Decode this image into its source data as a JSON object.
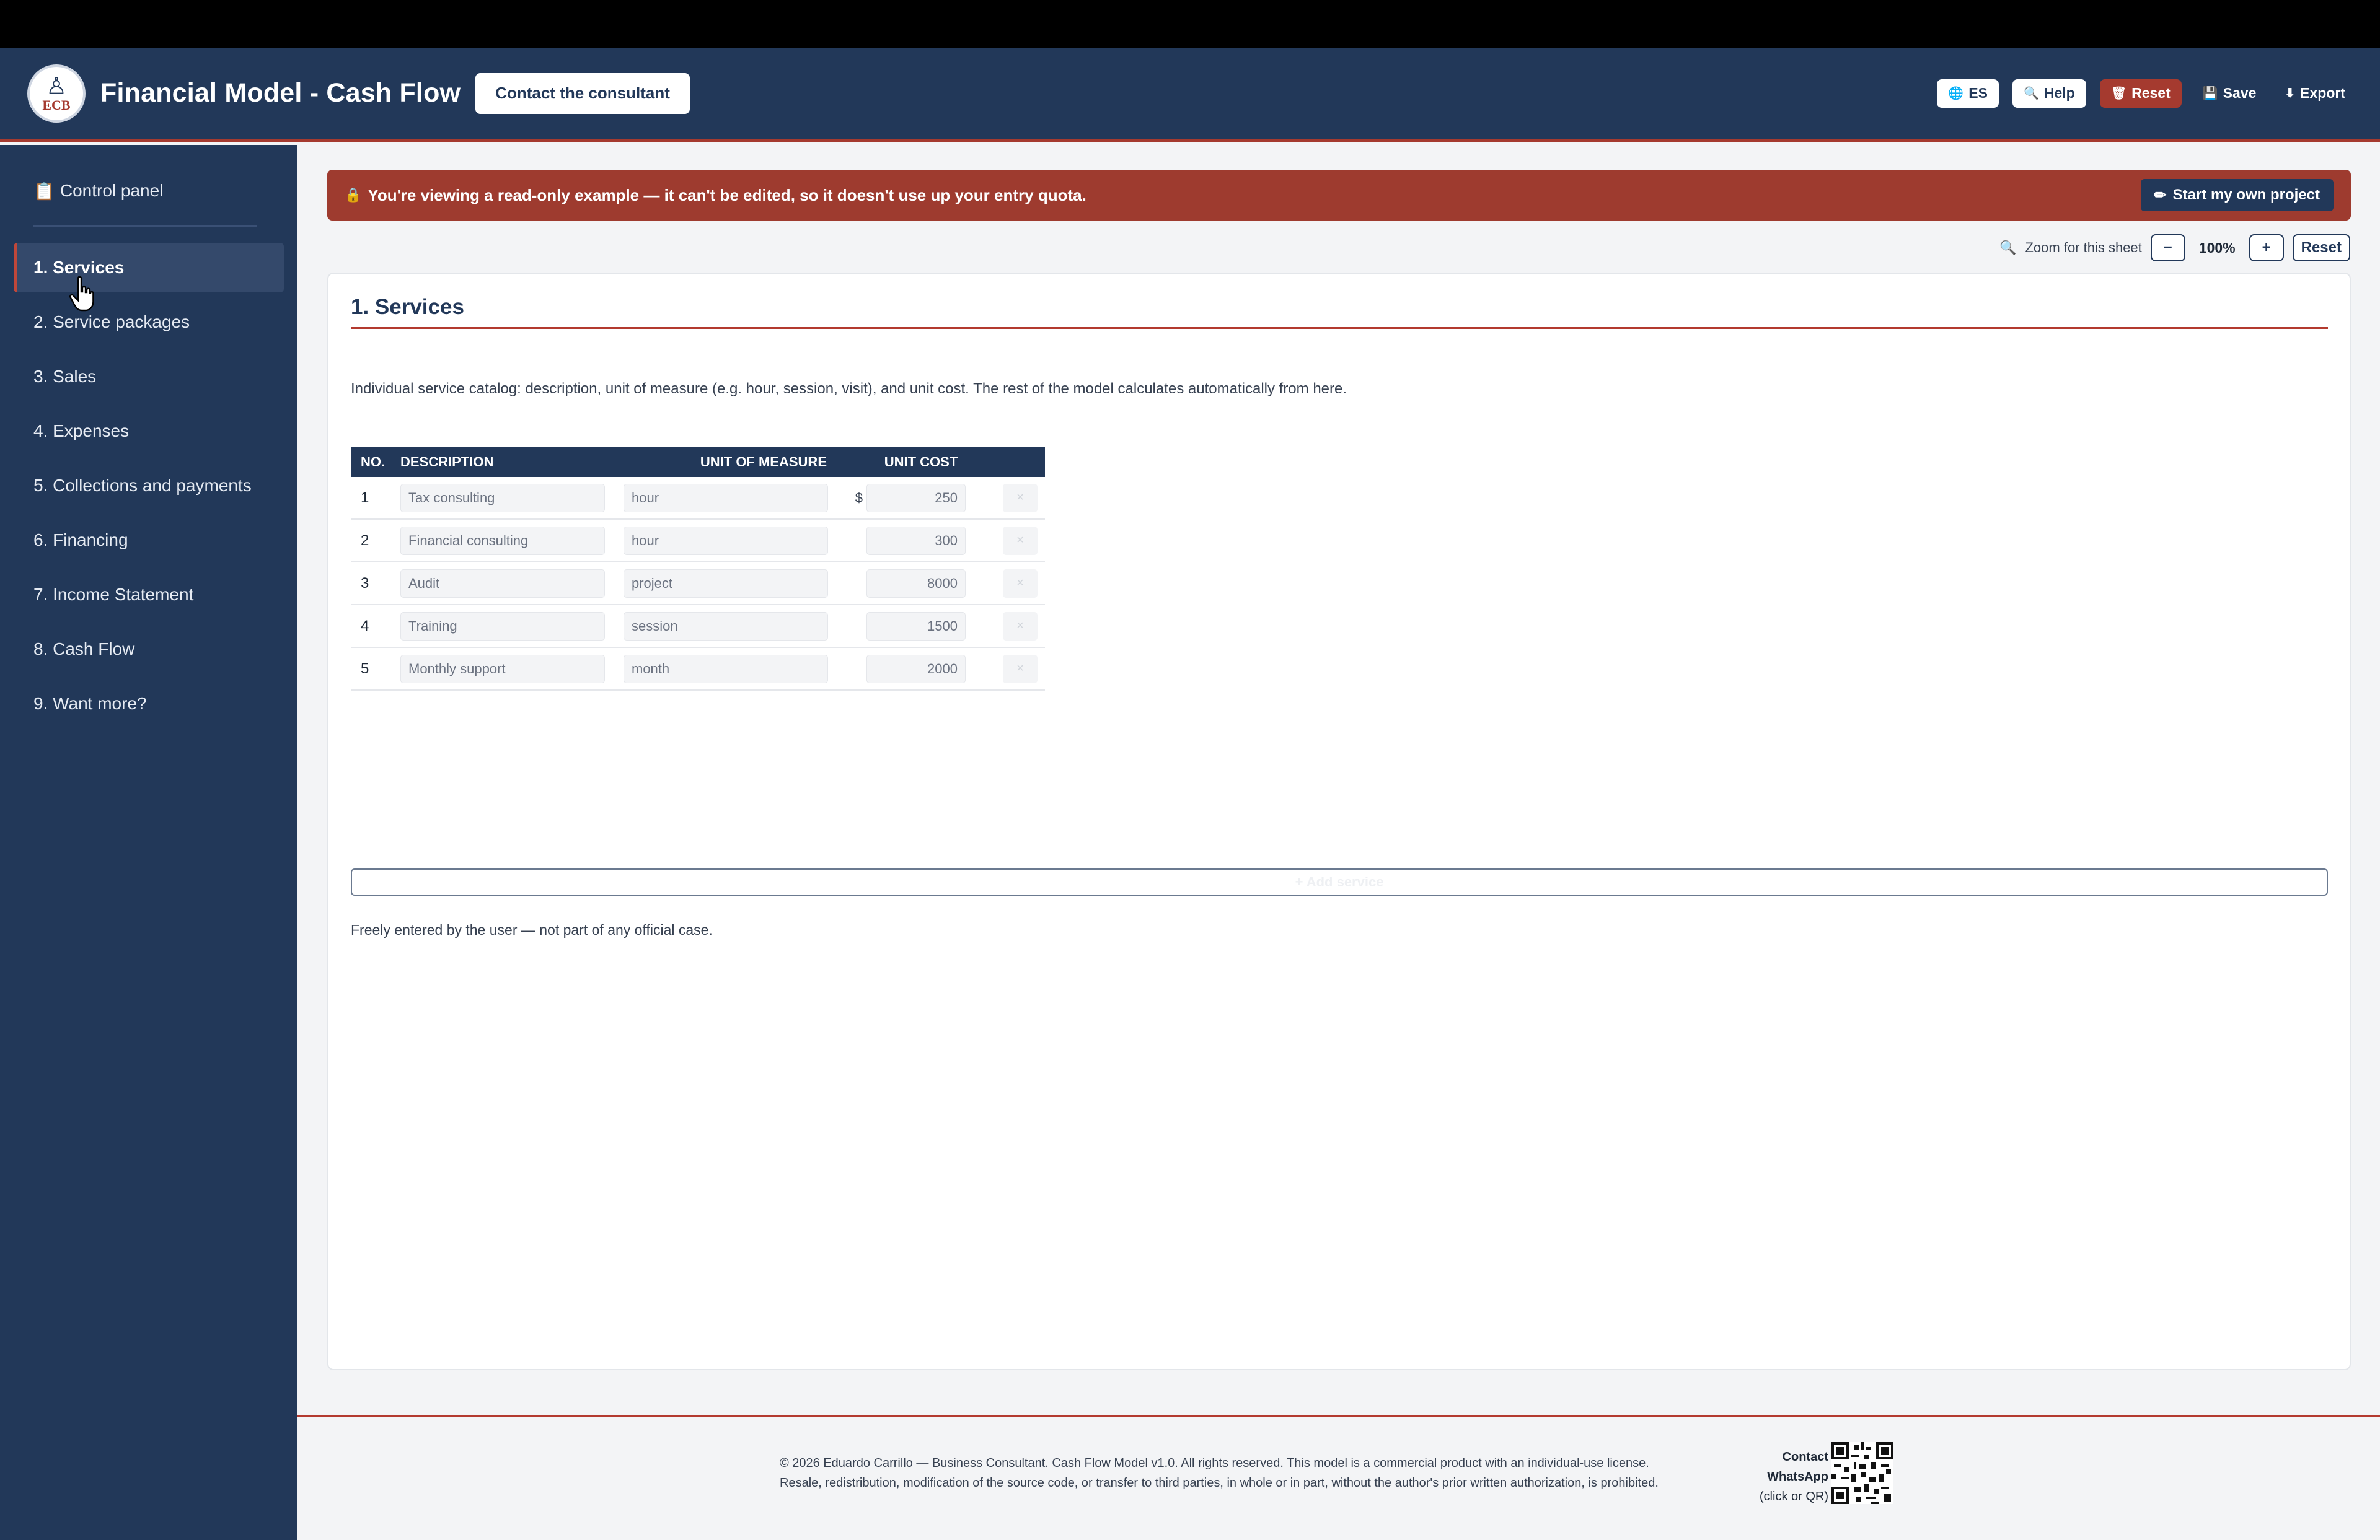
{
  "header": {
    "logo_text": "ECB",
    "title": "Financial Model - Cash Flow",
    "contact_label": "Contact the consultant",
    "lang_label": "ES",
    "help_label": "Help",
    "reset_label": "Reset",
    "save_label": "Save",
    "export_label": "Export"
  },
  "sidebar": {
    "control_panel": "Control panel",
    "items": [
      {
        "label": "1. Services"
      },
      {
        "label": "2. Service packages"
      },
      {
        "label": "3. Sales"
      },
      {
        "label": "4. Expenses"
      },
      {
        "label": "5. Collections and payments"
      },
      {
        "label": "6. Financing"
      },
      {
        "label": "7. Income Statement"
      },
      {
        "label": "8. Cash Flow"
      },
      {
        "label": "9. Want more?"
      }
    ]
  },
  "banner": {
    "text": "You're viewing a read-only example — it can't be edited, so it doesn't use up your entry quota.",
    "button": "Start my own project"
  },
  "zoom": {
    "label": "Zoom for this sheet",
    "minus": "−",
    "value": "100%",
    "plus": "+",
    "reset": "Reset"
  },
  "sheet": {
    "title": "1. Services",
    "description": "Individual service catalog: description, unit of measure (e.g. hour, session, visit), and unit cost. The rest of the model calculates automatically from here.",
    "columns": {
      "no": "NO.",
      "description": "DESCRIPTION",
      "unit": "UNIT OF MEASURE",
      "cost": "UNIT COST"
    },
    "currency": "$",
    "rows": [
      {
        "no": "1",
        "description": "Tax consulting",
        "unit": "hour",
        "cost": "250"
      },
      {
        "no": "2",
        "description": "Financial consulting",
        "unit": "hour",
        "cost": "300"
      },
      {
        "no": "3",
        "description": "Audit",
        "unit": "project",
        "cost": "8000"
      },
      {
        "no": "4",
        "description": "Training",
        "unit": "session",
        "cost": "1500"
      },
      {
        "no": "5",
        "description": "Monthly support",
        "unit": "month",
        "cost": "2000"
      }
    ],
    "delete_glyph": "×",
    "add_label": "+ Add service",
    "note": "Freely entered by the user — not part of any official case."
  },
  "footer": {
    "line1": "© 2026 Eduardo Carrillo — Business Consultant. Cash Flow Model v1.0. All rights reserved. This model is a commercial product with an individual-use license.",
    "line2": "Resale, redistribution, modification of the source code, or transfer to third parties, in whole or in part, without the author's prior written authorization, is prohibited.",
    "contact_title": "Contact",
    "contact_whatsapp": "WhatsApp",
    "contact_hint": "(click or QR)"
  },
  "colors": {
    "navy": "#223859",
    "accent_red": "#a53a2f",
    "background": "#f3f4f6"
  },
  "icons": {
    "globe": "globe-icon",
    "help": "magnifier-icon",
    "reset": "trash-icon",
    "save": "floppy-icon",
    "export": "download-icon",
    "lock": "lock-icon",
    "pencil": "pencil-icon",
    "zoom": "magnifier-icon",
    "clipboard": "clipboard-icon"
  }
}
